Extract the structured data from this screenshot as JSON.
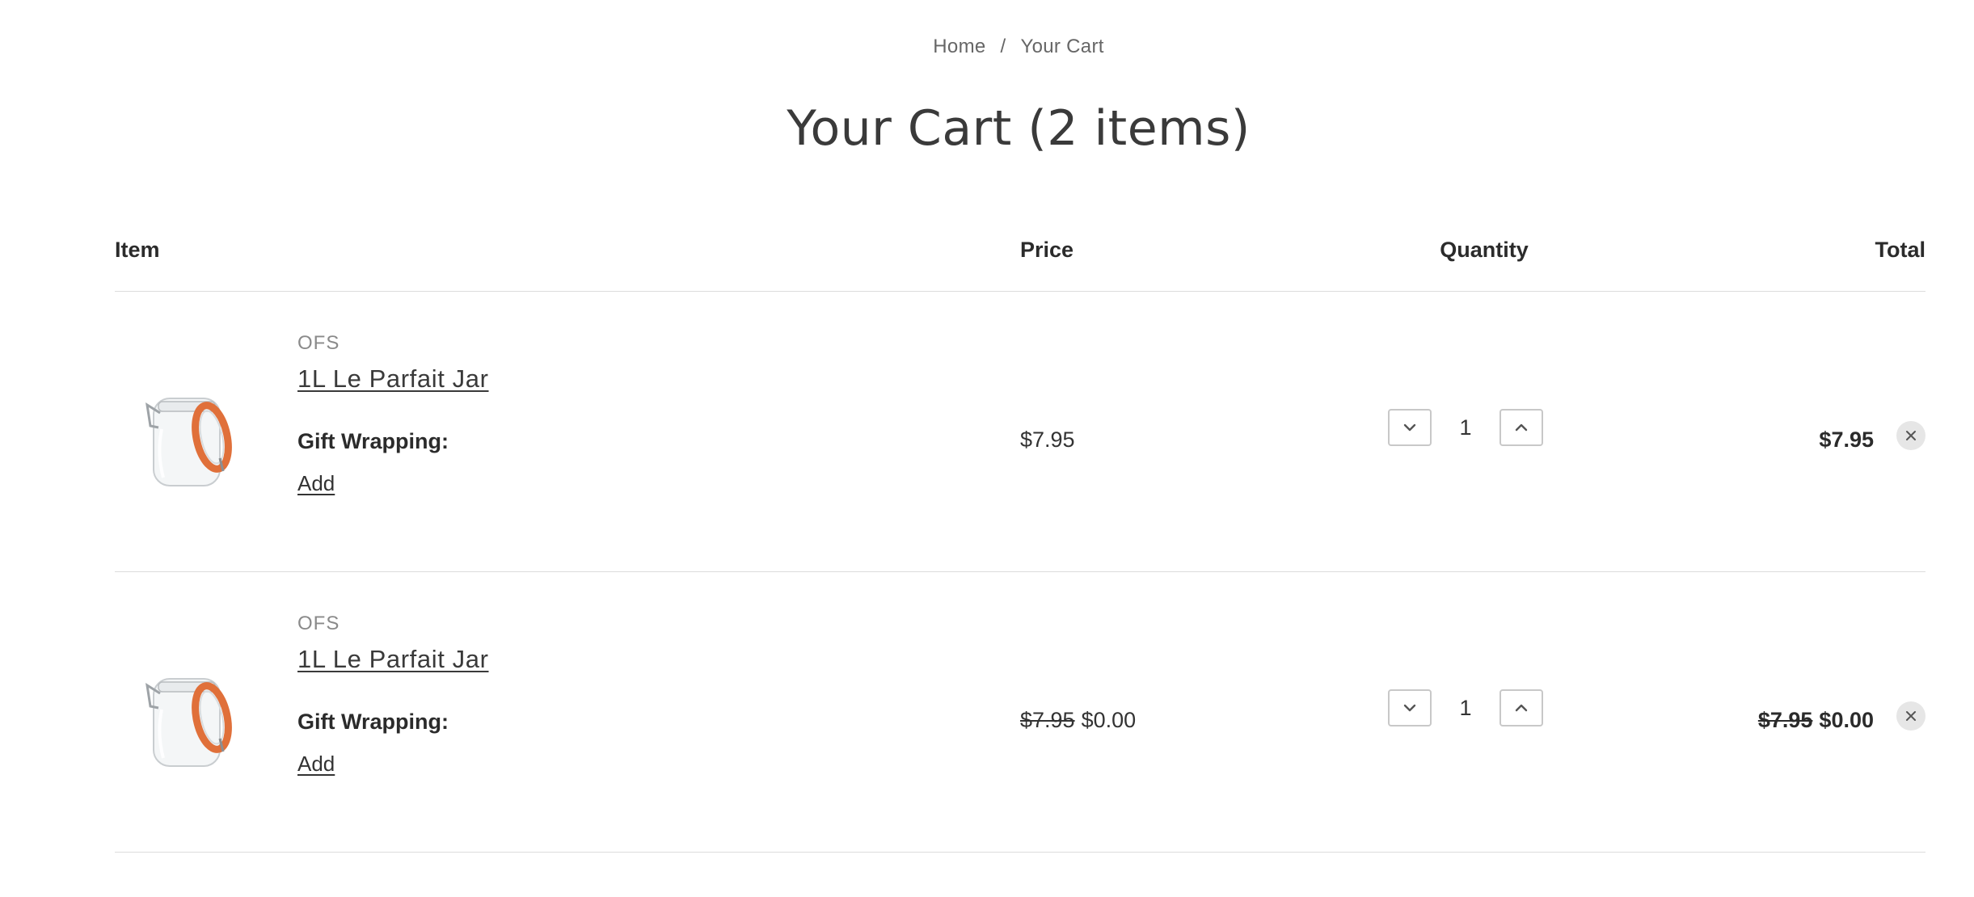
{
  "breadcrumb": {
    "home": "Home",
    "separator": "/",
    "current": "Your Cart"
  },
  "page_title": "Your Cart (2 items)",
  "table": {
    "headers": {
      "item": "Item",
      "price": "Price",
      "quantity": "Quantity",
      "total": "Total"
    }
  },
  "items": [
    {
      "brand": "OFS",
      "name": "1L Le Parfait Jar",
      "image_icon": "glass-jar-image",
      "gift_wrapping_label": "Gift Wrapping:",
      "gift_wrapping_action": "Add",
      "price_original": "",
      "price": "$7.95",
      "quantity": "1",
      "total_original": "",
      "total": "$7.95"
    },
    {
      "brand": "OFS",
      "name": "1L Le Parfait Jar",
      "image_icon": "glass-jar-image",
      "gift_wrapping_label": "Gift Wrapping:",
      "gift_wrapping_action": "Add",
      "price_original": "$7.95",
      "price": "$0.00",
      "quantity": "1",
      "total_original": "$7.95",
      "total": "$0.00"
    }
  ],
  "colors": {
    "text": "#333333",
    "muted": "#8a8a8a",
    "divider": "#dcdcdc",
    "jar_lid": "#e0703a",
    "remove_bg": "#e6e6e6"
  },
  "icons": {
    "decrease": "chevron-down-icon",
    "increase": "chevron-up-icon",
    "remove": "close-icon"
  }
}
